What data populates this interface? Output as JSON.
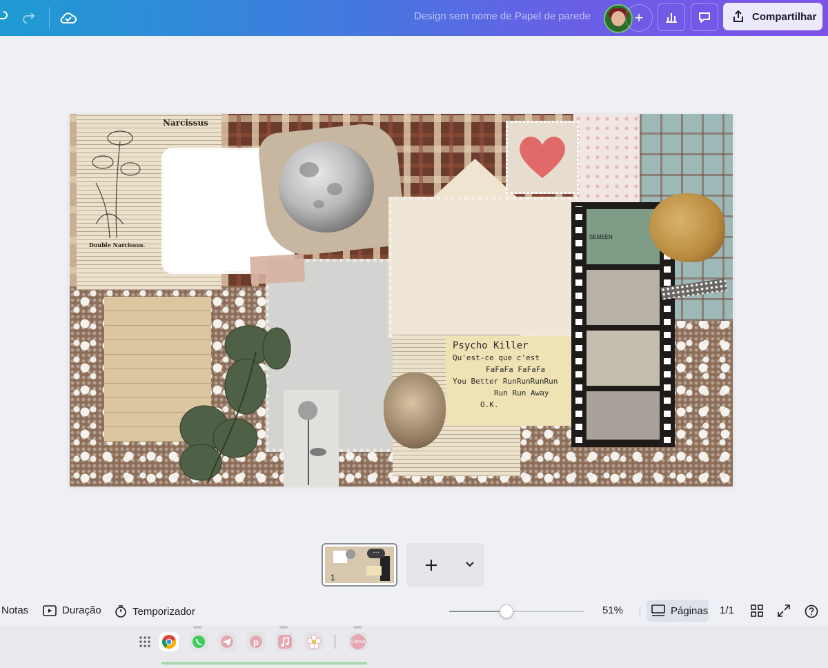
{
  "topbar": {
    "doc_title": "Design sem nome de Papel de parede",
    "share_label": "Compartilhar",
    "icons": [
      "undo-icon",
      "redo-icon",
      "cloud-saved-icon",
      "plus-icon",
      "chart-icon",
      "comment-icon",
      "share-icon"
    ],
    "gradient": [
      "#1f9bd1",
      "#7d52e8"
    ]
  },
  "canvas": {
    "note_text": [
      "Psycho Killer",
      "Qu'est-ce que c'est",
      "FaFaFa FaFaFa",
      "You Better RunRunRunRun",
      "Run Run Away",
      "O.K."
    ],
    "newsprint_heading": "Narcissus",
    "newsprint_caption": "Double Narcissus.",
    "ticket_text": "SEMEEN"
  },
  "pages": {
    "thumb_number": "1",
    "thumb_more": "···"
  },
  "bottombar": {
    "notes_label": "Notas",
    "duration_label": "Duração",
    "timer_label": "Temporizador",
    "zoom": "51%",
    "zoom_value": 0.51,
    "pages_label": "Páginas",
    "page_count": "1/1"
  },
  "dock": {
    "apps": [
      "apps-grid-icon",
      "chrome-icon",
      "whatsapp-icon",
      "telegram-icon",
      "pinterest-icon",
      "music-icon",
      "flower-app-icon",
      "canva-icon"
    ],
    "canva_label": "Canva"
  }
}
